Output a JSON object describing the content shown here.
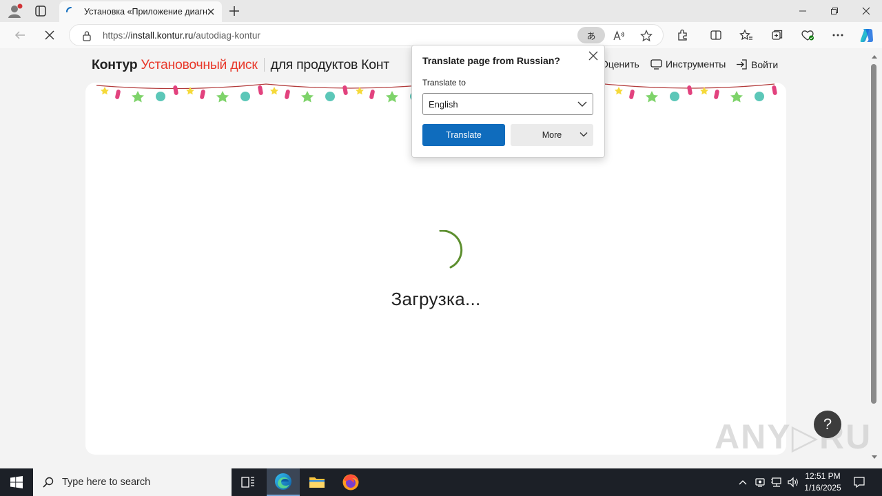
{
  "browser": {
    "tab": {
      "title": "Установка «Приложение диагн"
    },
    "address": {
      "url_prefix": "https://",
      "host": "install.kontur.ru",
      "path": "/autodiag-kontur"
    },
    "translate_pill": "あ"
  },
  "site": {
    "brand": "Контур",
    "brand_sub": "Установочный диск",
    "products": "для продуктов Конт",
    "nav": {
      "rate": "Оценить",
      "tools": "Инструменты",
      "login": "Войти"
    },
    "loading_text": "Загрузка...",
    "help_label": "?"
  },
  "translate_popup": {
    "title": "Translate page from Russian?",
    "translate_to_label": "Translate to",
    "selected_language": "English",
    "translate_button": "Translate",
    "more_button": "More"
  },
  "watermark": "ANY▷RUN",
  "taskbar": {
    "search_placeholder": "Type here to search",
    "time": "12:51 PM",
    "date": "1/16/2025"
  }
}
